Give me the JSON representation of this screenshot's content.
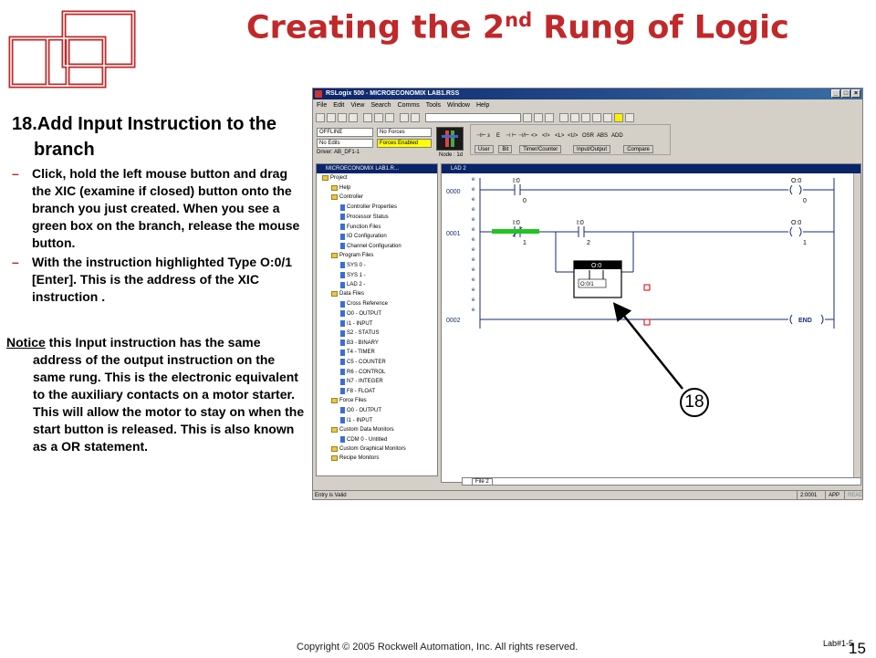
{
  "slide": {
    "title_main": "Creating the 2",
    "title_sup": "nd",
    "title_end": " Rung of Logic",
    "heading": "18.Add Input Instruction to the branch",
    "bullets": [
      "Click, hold the left mouse button and drag the XIC (examine if closed) button onto the branch you just created. When you see a green box on the branch, release the mouse button.",
      "With the instruction highlighted Type O:0/1 [Enter]. This is the address of the XIC instruction ."
    ],
    "notice_word": "Notice",
    "notice_rest": " this Input instruction has the same address of the output instruction on the same rung. This is the electronic equivalent to the auxiliary contacts on a motor starter. This will allow the motor to stay on when the start button is released. This is also known as a OR statement.",
    "footer": "Copyright © 2005 Rockwell Automation, Inc. All rights reserved.",
    "page_label": "Lab#1-5",
    "page_number": "15",
    "callout": "18"
  },
  "app": {
    "title": "RSLogix 500 - MICROECONOMIX LAB1.RSS",
    "menu": [
      "File",
      "Edit",
      "View",
      "Search",
      "Comms",
      "Tools",
      "Window",
      "Help"
    ],
    "status": {
      "mode": "OFFLINE",
      "forces": "No Forces",
      "edits": "No Edits",
      "forces_enabled": "Forces Enabled",
      "driver": "Driver: AB_DF1-1",
      "node": "Node : 1d"
    },
    "instruction_tabs": [
      "User",
      "Bit",
      "Timer/Counter",
      "Input/Output",
      "Compare"
    ],
    "tree_title": "MICROECONOMIX LAB1.R...",
    "tree": [
      {
        "label": "Project",
        "kind": "folder",
        "depth": 0
      },
      {
        "label": "Help",
        "kind": "folder",
        "depth": 1
      },
      {
        "label": "Controller",
        "kind": "folder",
        "depth": 1
      },
      {
        "label": "Controller Properties",
        "kind": "file",
        "depth": 2
      },
      {
        "label": "Processor Status",
        "kind": "file",
        "depth": 2
      },
      {
        "label": "Function Files",
        "kind": "file",
        "depth": 2
      },
      {
        "label": "IO Configuration",
        "kind": "file",
        "depth": 2
      },
      {
        "label": "Channel Configuration",
        "kind": "file",
        "depth": 2
      },
      {
        "label": "Program Files",
        "kind": "folder",
        "depth": 1
      },
      {
        "label": "SYS 0 -",
        "kind": "file",
        "depth": 2
      },
      {
        "label": "SYS 1 -",
        "kind": "file",
        "depth": 2
      },
      {
        "label": "LAD 2 -",
        "kind": "file",
        "depth": 2
      },
      {
        "label": "Data Files",
        "kind": "folder",
        "depth": 1
      },
      {
        "label": "Cross Reference",
        "kind": "file",
        "depth": 2
      },
      {
        "label": "O0 - OUTPUT",
        "kind": "file",
        "depth": 2
      },
      {
        "label": "I1 - INPUT",
        "kind": "file",
        "depth": 2
      },
      {
        "label": "S2 - STATUS",
        "kind": "file",
        "depth": 2
      },
      {
        "label": "B3 - BINARY",
        "kind": "file",
        "depth": 2
      },
      {
        "label": "T4 - TIMER",
        "kind": "file",
        "depth": 2
      },
      {
        "label": "C5 - COUNTER",
        "kind": "file",
        "depth": 2
      },
      {
        "label": "R6 - CONTROL",
        "kind": "file",
        "depth": 2
      },
      {
        "label": "N7 - INTEGER",
        "kind": "file",
        "depth": 2
      },
      {
        "label": "F8 - FLOAT",
        "kind": "file",
        "depth": 2
      },
      {
        "label": "Force Files",
        "kind": "folder",
        "depth": 1
      },
      {
        "label": "O0 - OUTPUT",
        "kind": "file",
        "depth": 2
      },
      {
        "label": "I1 - INPUT",
        "kind": "file",
        "depth": 2
      },
      {
        "label": "Custom Data Monitors",
        "kind": "folder",
        "depth": 1
      },
      {
        "label": "CDM 0 - Untitled",
        "kind": "file",
        "depth": 2
      },
      {
        "label": "Custom Graphical Monitors",
        "kind": "folder",
        "depth": 1
      },
      {
        "label": "Recipe Monitors",
        "kind": "folder",
        "depth": 1
      }
    ],
    "ladder_title": "LAD 2",
    "rung_numbers": [
      "0000",
      "0001",
      "0002"
    ],
    "rung0": {
      "in_addr": "I:0",
      "in_bit": "0",
      "out_addr": "O:0",
      "out_bit": "0"
    },
    "rung1": {
      "in1_addr": "I:0",
      "in1_bit": "1",
      "in2_addr": "I:0",
      "in2_bit": "2",
      "out_addr": "O:0",
      "out_bit": "1"
    },
    "branch_addr": "O:0",
    "branch_edit": "O:0/1",
    "end_label": "END",
    "file_tab": "File 2",
    "statusbar": {
      "message": "Entry is Valid",
      "pos": "2:0001",
      "app": "APP",
      "read": "READ"
    }
  }
}
